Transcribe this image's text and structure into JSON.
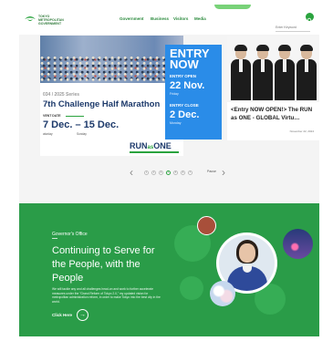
{
  "header": {
    "logo_lines": [
      "TOKYO",
      "METROPOLITAN",
      "GOVERNMENT"
    ],
    "nav": [
      "Government",
      "Business",
      "Visitors",
      "Media"
    ],
    "search_placeholder": "Enter Keyword"
  },
  "hero": {
    "marathon": {
      "series": "034 / 2025 Series",
      "title": "7th Challenge Half Marathon",
      "date_label": "VENT DATE",
      "dates": "7 Dec. – 15 Dec.",
      "day1": "aturday",
      "day2": "Sunday",
      "brand_run": "RUN",
      "brand_as": "as",
      "brand_one": "ONE"
    },
    "entry": {
      "headline": "ENTRY NOW",
      "open_label": "ENTRY OPEN",
      "open_date": "22 Nov.",
      "open_day": "Friday",
      "close_label": "ENTRY CLOSE",
      "close_date": "2 Dec.",
      "close_day": "Monday"
    },
    "news": {
      "title": "<Entry NOW OPEN!> The RUN as ONE - GLOBAL Virtu…",
      "date": "November 22, 2024"
    }
  },
  "pager": {
    "prev": "‹",
    "next": "›",
    "pages": [
      "1",
      "2",
      "3",
      "4",
      "5",
      "6",
      "7"
    ],
    "active_index": 3,
    "pause_label": "Pause"
  },
  "governor": {
    "label": "Governor's Office",
    "headline": "Continuing to Serve for the People, with the People",
    "body": "We will tackle any and all challenges head-on and work to further accelerate measures under the \"Grand Reform of Tokyo 2.0,\" my updated vision for metropolitan administration reform, in order to make Tokyo into the best city in the world.",
    "cta": "Click Here",
    "cta_icon": "arrow-right-icon"
  },
  "colors": {
    "brand_green": "#2a9c48",
    "entry_blue": "#2a8ce8",
    "navy": "#1d3a6b"
  }
}
